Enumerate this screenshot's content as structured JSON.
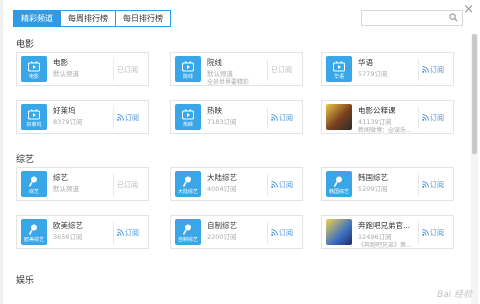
{
  "colors": {
    "accent": "#2f9be6",
    "tile": "#39a6e8",
    "subscribe": "#3a8fd9",
    "done": "#b8b8b8"
  },
  "header": {
    "close_label": "×",
    "tabs": [
      {
        "label": "精彩频道",
        "active": true
      },
      {
        "label": "每周排行榜",
        "active": false
      },
      {
        "label": "每日排行榜",
        "active": false
      }
    ],
    "search": {
      "value": "",
      "placeholder": ""
    }
  },
  "sections": [
    {
      "title": "电影",
      "cards": [
        {
          "name": "电影",
          "sub": "默认频道",
          "sub2": "",
          "tile_label": "电影",
          "tile_icon": "film-icon",
          "action": "已订阅",
          "subscribed": true
        },
        {
          "name": "院线",
          "sub": "默认频道",
          "sub2": "全员世界要精彩",
          "tile_label": "院线",
          "tile_icon": "film-icon",
          "action": "已订阅",
          "subscribed": true
        },
        {
          "name": "华语",
          "sub": "5779订阅",
          "sub2": "",
          "tile_label": "华语",
          "tile_icon": "film-icon",
          "action": "订阅",
          "subscribed": false
        },
        {
          "name": "好莱坞",
          "sub": "8379订阅",
          "sub2": "",
          "tile_label": "好莱坞",
          "tile_icon": "film-icon",
          "action": "订阅",
          "subscribed": false
        },
        {
          "name": "热映",
          "sub": "7183订阅",
          "sub2": "",
          "tile_label": "热映",
          "tile_icon": "film-icon",
          "action": "订阅",
          "subscribed": false
        },
        {
          "name": "电影公释课",
          "sub": "41139订阅",
          "sub2": "新闻微博：@误乐...",
          "tile_label": "",
          "tile_icon": "photo",
          "action": "订阅",
          "subscribed": false
        }
      ]
    },
    {
      "title": "综艺",
      "cards": [
        {
          "name": "综艺",
          "sub": "默认频道",
          "sub2": "",
          "tile_label": "综艺",
          "tile_icon": "microphone-icon",
          "action": "已订阅",
          "subscribed": true
        },
        {
          "name": "大陆综艺",
          "sub": "4004订阅",
          "sub2": "",
          "tile_label": "大陆综艺",
          "tile_icon": "microphone-icon",
          "action": "订阅",
          "subscribed": false
        },
        {
          "name": "韩国综艺",
          "sub": "5209订阅",
          "sub2": "",
          "tile_label": "韩国综艺",
          "tile_icon": "microphone-icon",
          "action": "订阅",
          "subscribed": false
        },
        {
          "name": "欧美综艺",
          "sub": "3656订阅",
          "sub2": "",
          "tile_label": "欧美综艺",
          "tile_icon": "microphone-icon",
          "action": "订阅",
          "subscribed": false
        },
        {
          "name": "自制综艺",
          "sub": "2200订阅",
          "sub2": "",
          "tile_label": "自制综艺",
          "tile_icon": "microphone-icon",
          "action": "订阅",
          "subscribed": false
        },
        {
          "name": "奔跑吧兄弟官...",
          "sub": "12496订阅",
          "sub2": "《奔跑吧兄弟》第...",
          "tile_label": "",
          "tile_icon": "photo2",
          "action": "订阅",
          "subscribed": false
        }
      ]
    },
    {
      "title": "娱乐",
      "cards": []
    }
  ],
  "watermark": "Bai 经验"
}
